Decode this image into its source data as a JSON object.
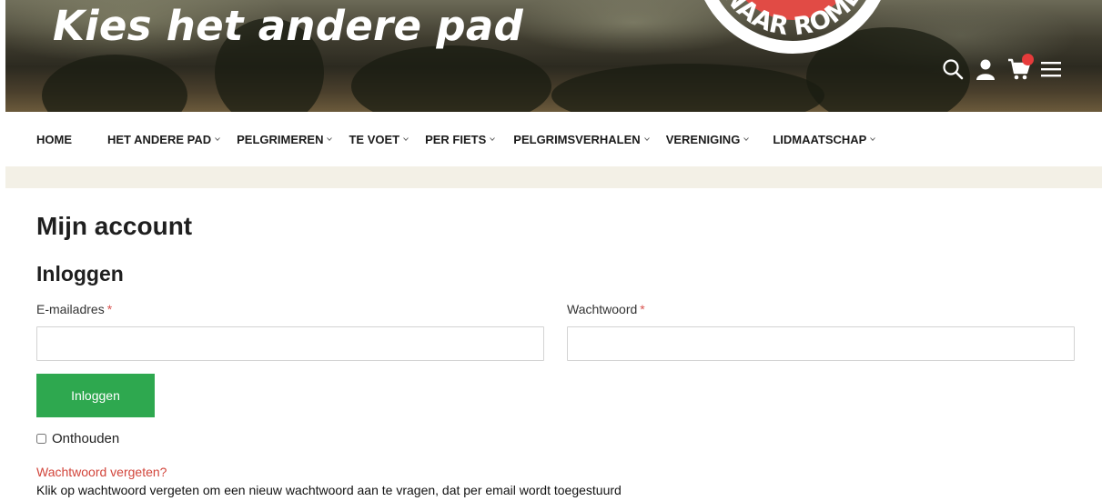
{
  "hero": {
    "tagline": "Kies het andere pad",
    "logo_text": "NAAR ROME"
  },
  "header_icons": [
    "search-icon",
    "user-icon",
    "cart-icon",
    "menu-icon"
  ],
  "nav": {
    "items": [
      {
        "label": "HOME",
        "has_dropdown": false
      },
      {
        "label": "HET ANDERE PAD",
        "has_dropdown": true
      },
      {
        "label": "PELGRIMEREN",
        "has_dropdown": true
      },
      {
        "label": "TE VOET",
        "has_dropdown": true
      },
      {
        "label": "PER FIETS",
        "has_dropdown": true
      },
      {
        "label": "PELGRIMSVERHALEN",
        "has_dropdown": true
      },
      {
        "label": "VERENIGING",
        "has_dropdown": true
      },
      {
        "label": "LIDMAATSCHAP",
        "has_dropdown": true
      }
    ]
  },
  "main": {
    "page_title": "Mijn account",
    "section_title": "Inloggen",
    "email_label": "E-mailadres",
    "password_label": "Wachtwoord",
    "required_mark": "*",
    "email_value": "",
    "password_value": "",
    "login_button": "Inloggen",
    "remember_label": "Onthouden",
    "remember_checked": false,
    "forgot_link": "Wachtwoord vergeten?",
    "forgot_hint": "Klik op wachtwoord vergeten om een nieuw wachtwoord aan te vragen, dat per email wordt toegestuurd"
  },
  "colors": {
    "accent_green": "#2ea84f",
    "link_red": "#d2453b",
    "required_red": "#d9534f",
    "band_beige": "#f3f0e6",
    "cart_badge": "#e63b3b"
  }
}
